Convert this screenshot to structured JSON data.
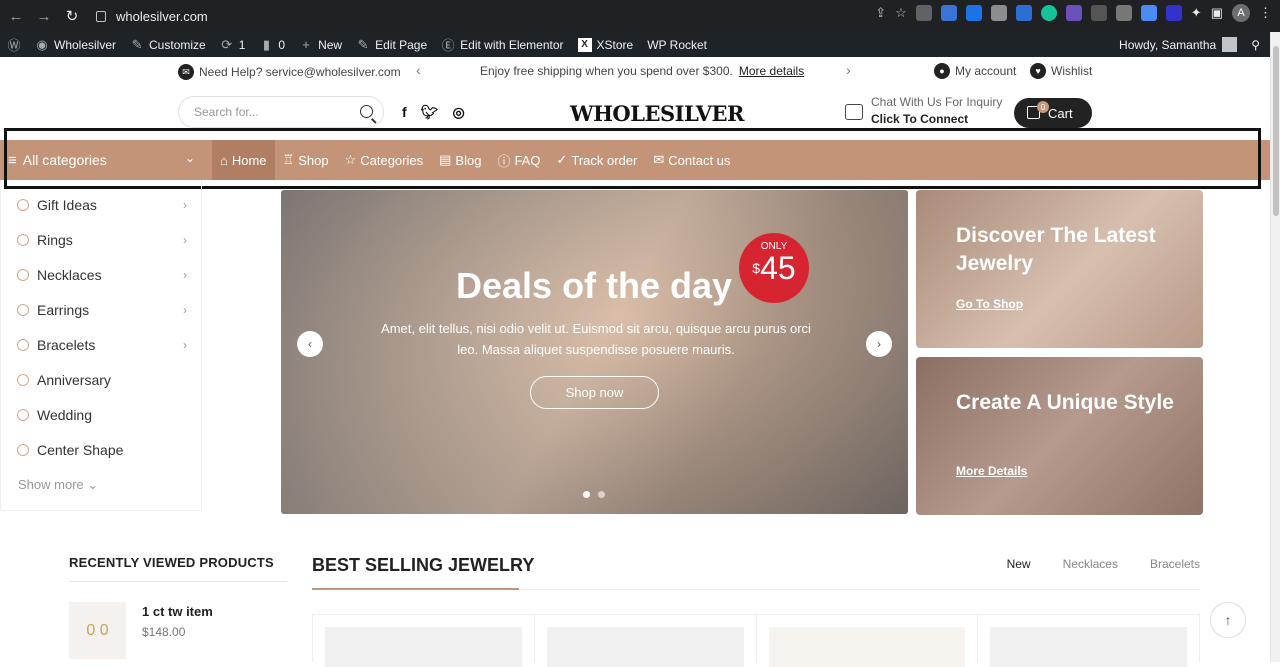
{
  "browser": {
    "url": "wholesilver.com",
    "profile_initial": "A"
  },
  "wp_admin_bar": {
    "items": [
      "Wholesilver",
      "Customize",
      "1",
      "0",
      "New",
      "Edit Page",
      "Edit with Elementor",
      "XStore",
      "WP Rocket"
    ],
    "howdy": "Howdy, Samantha"
  },
  "top_info": {
    "help": "Need Help? service@wholesilver.com",
    "promo": "Enjoy free shipping when you spend over $300.",
    "promo_link": "More details",
    "account": "My account",
    "wishlist": "Wishlist"
  },
  "header": {
    "search_placeholder": "Search for...",
    "logo": "WHOLESILVER",
    "chat_line1": "Chat With Us For Inquiry",
    "chat_line2": "Click To Connect",
    "cart_label": "Cart",
    "cart_count": "0"
  },
  "menu": {
    "all_categories": "All categories",
    "items": [
      {
        "label": "Home",
        "icon": "⌂"
      },
      {
        "label": "Shop",
        "icon": "♖"
      },
      {
        "label": "Categories",
        "icon": "☆"
      },
      {
        "label": "Blog",
        "icon": "▤"
      },
      {
        "label": "FAQ",
        "icon": "ⓘ"
      },
      {
        "label": "Track order",
        "icon": "✓"
      },
      {
        "label": "Contact us",
        "icon": "✉"
      }
    ]
  },
  "sidebar": {
    "categories": [
      {
        "label": "Gift Ideas",
        "has_sub": true
      },
      {
        "label": "Rings",
        "has_sub": true
      },
      {
        "label": "Necklaces",
        "has_sub": true
      },
      {
        "label": "Earrings",
        "has_sub": true
      },
      {
        "label": "Bracelets",
        "has_sub": true
      },
      {
        "label": "Anniversary",
        "has_sub": false
      },
      {
        "label": "Wedding",
        "has_sub": false
      },
      {
        "label": "Center Shape",
        "has_sub": false
      }
    ],
    "show_more": "Show more"
  },
  "hero": {
    "title": "Deals of the day",
    "price_tag": "ONLY",
    "currency": "$",
    "price": "45",
    "description": "Amet, elit tellus, nisi odio velit ut. Euismod sit arcu, quisque arcu purus orci leo. Massa aliquet suspendisse posuere mauris.",
    "button": "Shop now"
  },
  "promos": [
    {
      "title": "Discover The Latest Jewelry",
      "link": "Go To Shop"
    },
    {
      "title": "Create A Unique Style",
      "link": "More Details"
    }
  ],
  "recently_viewed": {
    "heading": "RECENTLY VIEWED PRODUCTS",
    "item_name": "1 ct tw item",
    "item_price": "$148.00"
  },
  "best_selling": {
    "heading": "BEST SELLING JEWELRY",
    "tabs": [
      "New",
      "Necklaces",
      "Bracelets"
    ]
  },
  "colors": {
    "accent": "#c49479",
    "accent_dark": "#b07e63",
    "sale_red": "#d62430"
  }
}
